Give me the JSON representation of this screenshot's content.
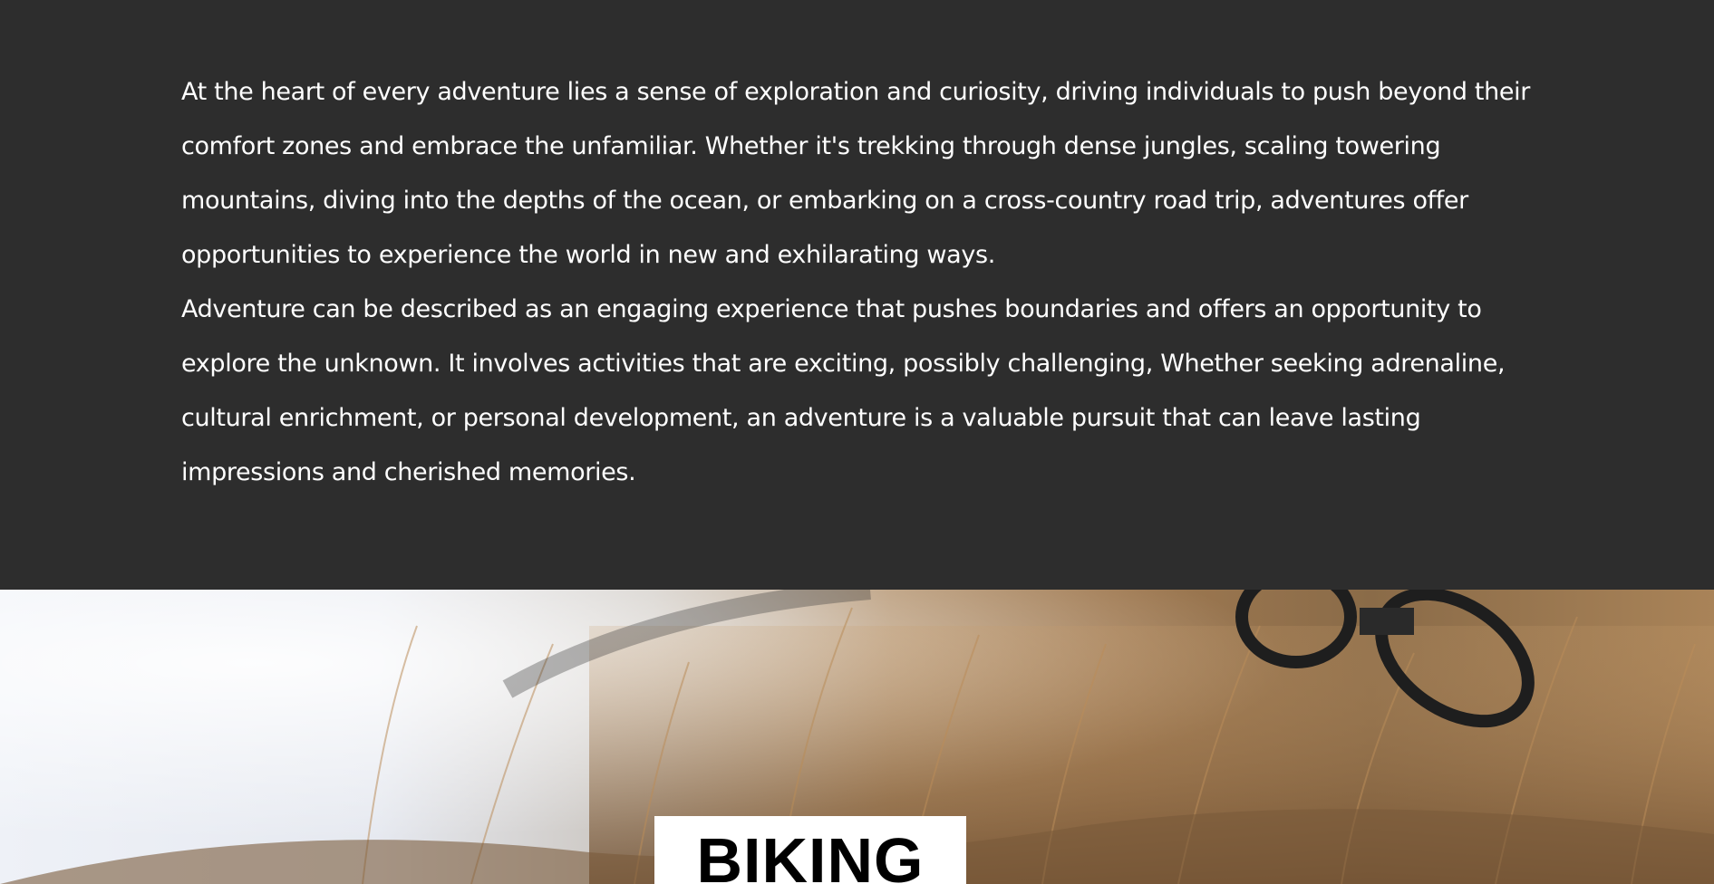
{
  "intro": {
    "paragraph_1": "At the heart of every adventure lies a sense of exploration and curiosity, driving individuals to push beyond their comfort zones and embrace the unfamiliar. Whether it's trekking through dense jungles, scaling towering mountains, diving into the depths of the ocean, or embarking on a cross-country road trip, adventures offer opportunities to experience the world in new and exhilarating ways.",
    "paragraph_2": "Adventure can be described as an engaging experience that pushes boundaries and offers an opportunity to explore the unknown. It involves activities that are exciting, possibly challenging, Whether seeking adrenaline, cultural enrichment, or personal development, an adventure is a valuable pursuit that can leave lasting impressions and cherished memories."
  },
  "hero": {
    "label": "BIKING"
  },
  "colors": {
    "background": "#2d2d2d",
    "text": "#ffffff",
    "label_background": "#ffffff",
    "label_text": "#000000"
  }
}
